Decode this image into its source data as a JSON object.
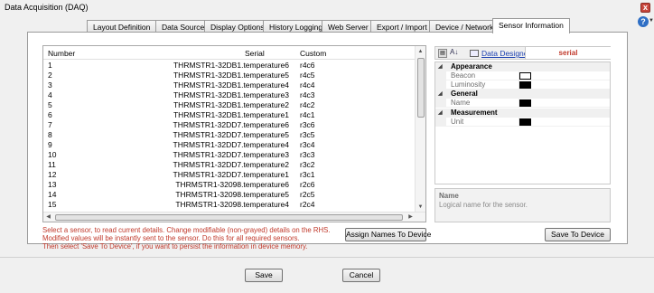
{
  "window": {
    "title": "Data Acquisition (DAQ)",
    "close_glyph": "x",
    "help_glyph": "?"
  },
  "tabs": [
    {
      "label": "Layout Definition"
    },
    {
      "label": "Data Source"
    },
    {
      "label": "Display Options"
    },
    {
      "label": "History Logging"
    },
    {
      "label": "Web Server"
    },
    {
      "label": "Export / Import"
    },
    {
      "label": "Device / Network"
    },
    {
      "label": "Sensor Information",
      "active": true
    }
  ],
  "grid": {
    "columns": {
      "number": "Number",
      "serial": "Serial",
      "custom": "Custom"
    },
    "rows": [
      {
        "number": "1",
        "serial": "THRMSTR1-32DB1.temperature6",
        "custom": "r4c6"
      },
      {
        "number": "2",
        "serial": "THRMSTR1-32DB1.temperature5",
        "custom": "r4c5"
      },
      {
        "number": "3",
        "serial": "THRMSTR1-32DB1.temperature4",
        "custom": "r4c4"
      },
      {
        "number": "4",
        "serial": "THRMSTR1-32DB1.temperature3",
        "custom": "r4c3"
      },
      {
        "number": "5",
        "serial": "THRMSTR1-32DB1.temperature2",
        "custom": "r4c2"
      },
      {
        "number": "6",
        "serial": "THRMSTR1-32DB1.temperature1",
        "custom": "r4c1"
      },
      {
        "number": "7",
        "serial": "THRMSTR1-32DD7.temperature6",
        "custom": "r3c6"
      },
      {
        "number": "8",
        "serial": "THRMSTR1-32DD7.temperature5",
        "custom": "r3c5"
      },
      {
        "number": "9",
        "serial": "THRMSTR1-32DD7.temperature4",
        "custom": "r3c4"
      },
      {
        "number": "10",
        "serial": "THRMSTR1-32DD7.temperature3",
        "custom": "r3c3"
      },
      {
        "number": "11",
        "serial": "THRMSTR1-32DD7.temperature2",
        "custom": "r3c2"
      },
      {
        "number": "12",
        "serial": "THRMSTR1-32DD7.temperature1",
        "custom": "r3c1"
      },
      {
        "number": "13",
        "serial": "THRMSTR1-32098.temperature6",
        "custom": "r2c6"
      },
      {
        "number": "14",
        "serial": "THRMSTR1-32098.temperature5",
        "custom": "r2c5"
      },
      {
        "number": "15",
        "serial": "THRMSTR1-32098.temperature4",
        "custom": "r2c4"
      }
    ]
  },
  "help_lines": [
    "Select a sensor, to read current details. Change modifiable (non-grayed) details on the RHS.",
    "Modified values will be instantly sent to the sensor. Do this for all required sensors.",
    "Then select 'Save To Device', if you want to persist the information in device memory."
  ],
  "buttons": {
    "assign": "Assign Names To Device",
    "save_to_device": "Save To Device",
    "save": "Save",
    "cancel": "Cancel"
  },
  "property_grid": {
    "toolbar": {
      "data_designer": "Data Designer",
      "selected": "serial"
    },
    "categories": [
      {
        "name": "Appearance",
        "props": [
          {
            "name": "Beacon",
            "swatch": "#ffffff"
          },
          {
            "name": "Luminosity",
            "swatch": "#000000"
          }
        ]
      },
      {
        "name": "General",
        "props": [
          {
            "name": "Name",
            "swatch": "#000000"
          }
        ]
      },
      {
        "name": "Measurement",
        "props": [
          {
            "name": "Unit",
            "swatch": "#000000"
          }
        ]
      }
    ],
    "description": {
      "title": "Name",
      "text": "Logical name for the sensor."
    }
  },
  "colors": {
    "help_text": "#c0392b",
    "link": "#1a3fb0"
  }
}
